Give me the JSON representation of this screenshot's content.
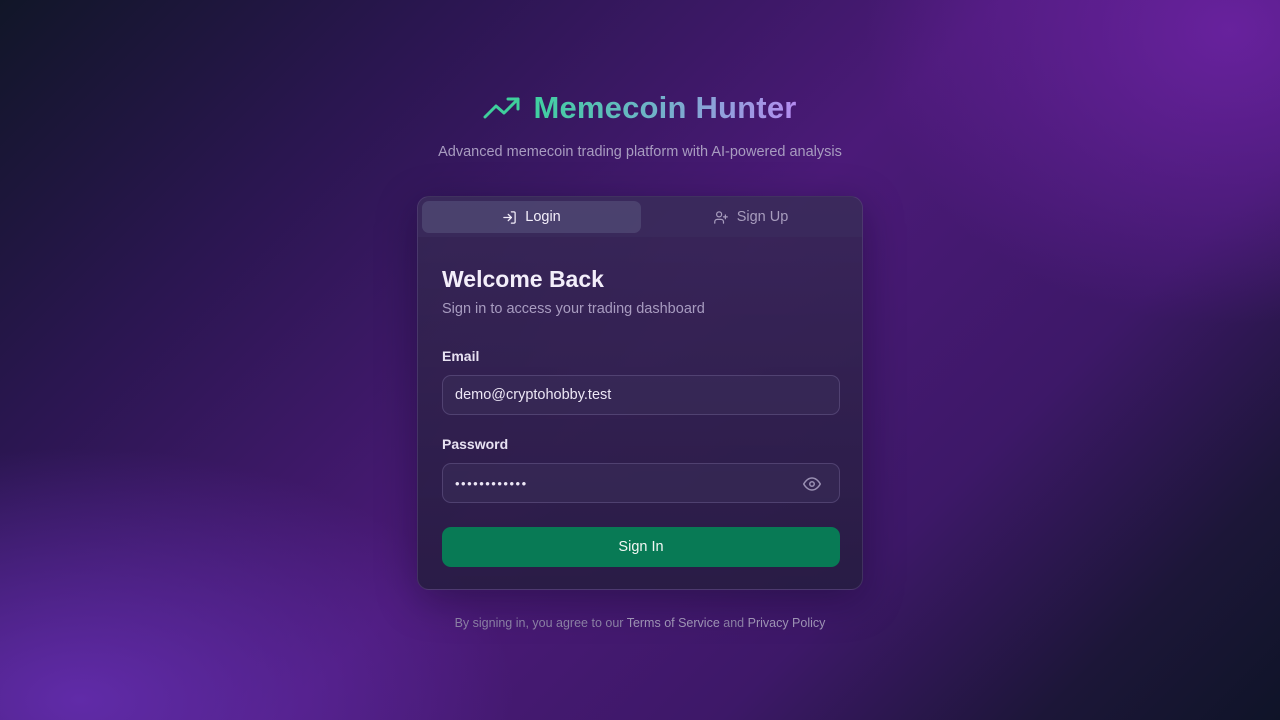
{
  "brand": {
    "title": "Memecoin Hunter",
    "icon": "trending-up-icon",
    "subtitle": "Advanced memecoin trading platform with AI-powered analysis",
    "gradient": [
      "#3fd0a0",
      "#b48cf0"
    ]
  },
  "tabs": [
    {
      "label": "Login",
      "icon": "log-in-icon",
      "active": true
    },
    {
      "label": "Sign Up",
      "icon": "user-plus-icon",
      "active": false
    }
  ],
  "form": {
    "title": "Welcome Back",
    "description": "Sign in to access your trading dashboard",
    "email": {
      "label": "Email",
      "value": "demo@cryptohobby.test"
    },
    "password": {
      "label": "Password",
      "value": "••••••••••••",
      "toggle_icon": "eye-icon"
    },
    "submit_label": "Sign In",
    "accent_color": "#087a55"
  },
  "footer": {
    "prefix": "By signing in, you agree to our",
    "terms": "Terms of Service",
    "conjunction": "and",
    "privacy": "Privacy Policy"
  }
}
